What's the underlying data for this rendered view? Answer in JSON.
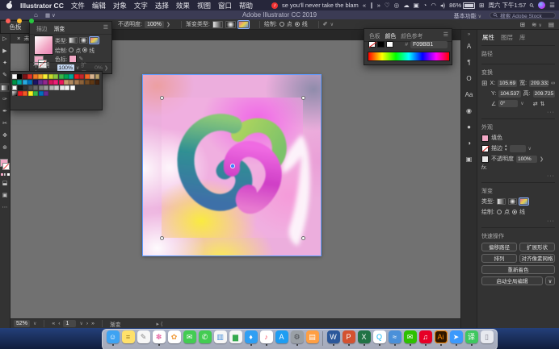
{
  "menu_bar": {
    "app_menu": "Illustrator CC",
    "menus": [
      "文件",
      "编辑",
      "对象",
      "文字",
      "选择",
      "效果",
      "视图",
      "窗口",
      "帮助"
    ],
    "now_playing": "se you'll never take the blam",
    "battery": "86%",
    "clock": "周六 下午1:57"
  },
  "title_bar": {
    "title": "Adobe Illustrator CC 2019",
    "workspace": "基本功能",
    "stock_search_placeholder": "搜索 Adobe Stock"
  },
  "options_bar": {
    "opacity_label": "不透明度:",
    "opacity_value": "100%",
    "gradient_type_label": "渐变类型:",
    "draw_label": "绘制:",
    "draw_point": "点",
    "draw_line": "线"
  },
  "document_tab": {
    "close": "×",
    "title": "未标题"
  },
  "swatches_panel_tab": "色板",
  "gradient_panel": {
    "tabs": [
      "描边",
      "渐变"
    ],
    "type_label": "类型:",
    "draw_label": "绘制:",
    "draw_point": "点",
    "draw_line": "线",
    "stops_label": "色标:",
    "opacity_label": "不透明度:",
    "opacity_value": "100%",
    "spread_label": "扩展:",
    "spread_value": "0%"
  },
  "swatches": {
    "rows": [
      [
        "#ffffff",
        "#000000",
        "#7c1316",
        "#e2322a",
        "#ef7923",
        "#f3a72e",
        "#f8ef34",
        "#c5d92d",
        "#8cc63f",
        "#39b54a",
        "#00a651",
        "#00a99d",
        "#ed1c24",
        "#c1272d",
        "#f26522",
        "#d9b48f",
        "#b8a06a"
      ],
      [
        "#009245",
        "#00a99d",
        "#29abe2",
        "#0071bc",
        "#1b1464",
        "#662d91",
        "#93278f",
        "#d4145a",
        "#ed1e79",
        "#ed145b",
        "#c69c6e",
        "#b0895f",
        "#a67c52",
        "#8c6239",
        "#754c24",
        "#603813",
        "#42210b"
      ],
      [
        "reg",
        "#1a1a1a",
        "#333333",
        "#4d4d4d",
        "#666666",
        "#808080",
        "#999999",
        "#b3b3b3",
        "#cccccc",
        "#e6e6e6",
        "#f2f2f2",
        "#ffffff"
      ],
      [
        "grad",
        "#ed1c24",
        "#f15a24",
        "#fcee21",
        "#39b54a",
        "#0071bc",
        "#662d91"
      ]
    ]
  },
  "color_panel": {
    "tabs": [
      "色板",
      "颜色",
      "颜色参考"
    ],
    "hex_label": "#",
    "hex_value": "F09BB1"
  },
  "properties_panel": {
    "tabs": [
      "属性",
      "图层",
      "库"
    ],
    "selection_type": "路径",
    "transform": {
      "title": "变换",
      "x_label": "X:",
      "x": "105.69 p",
      "w_label": "宽:",
      "w": "209.333",
      "y_label": "Y:",
      "y": "104.537",
      "h_label": "高:",
      "h": "209.725",
      "angle": "0°",
      "more": "···"
    },
    "appearance": {
      "title": "外观",
      "fill_label": "填色",
      "stroke_label": "描边",
      "opacity_label": "不透明度",
      "opacity_value": "100%",
      "fx": "fx.",
      "more": "···"
    },
    "gradient_section": {
      "title": "渐变",
      "type_label": "类型:",
      "draw_label": "绘制:",
      "draw_point": "点",
      "draw_line": "线",
      "more": "···"
    },
    "quick_actions": {
      "title": "快速操作",
      "buttons": [
        "偏移路径",
        "扩展形状",
        "排列",
        "对齐像素网格",
        "重新着色",
        "启动全局编辑"
      ]
    }
  },
  "status_bar": {
    "zoom": "52%",
    "artboard": "1",
    "tool": "渐变"
  },
  "canvas": {
    "selection_color": "#5f9bff",
    "stop_color": "#F09BB1",
    "artwork_colors": [
      "#ecaedd",
      "#f8ef34",
      "#e85fe0",
      "#2f8f93",
      "#8bc878",
      "#cf3ec6",
      "#ffffff"
    ]
  },
  "tools": [
    {
      "name": "selection-tool",
      "glyph": "▷"
    },
    {
      "name": "direct-selection-tool",
      "glyph": "▶"
    },
    {
      "name": "magic-wand-tool",
      "glyph": "✦"
    },
    {
      "name": "shaper-tool",
      "glyph": "✎"
    },
    {
      "name": "gradient-tool",
      "glyph": "",
      "selected": true
    },
    {
      "name": "eyedropper-tool",
      "glyph": "✑"
    },
    {
      "name": "pen-tool",
      "glyph": "✒"
    },
    {
      "name": "scissors-tool",
      "glyph": "✂"
    },
    {
      "name": "hand-tool",
      "glyph": "✥"
    },
    {
      "name": "zoom-tool",
      "glyph": "⊕"
    }
  ],
  "right_strip_icons": [
    {
      "name": "character-panel",
      "glyph": "A"
    },
    {
      "name": "paragraph-panel",
      "glyph": "¶"
    },
    {
      "name": "opentype-panel",
      "glyph": "O"
    },
    {
      "name": "glyphs-panel",
      "glyph": "Aa"
    },
    {
      "name": "appearance-panel",
      "glyph": "◉"
    },
    {
      "name": "color-panel",
      "glyph": "●"
    },
    {
      "name": "transparency-panel",
      "glyph": "◑"
    },
    {
      "name": "artboards-panel",
      "glyph": "▣"
    }
  ],
  "dock": {
    "apps": [
      {
        "name": "finder",
        "glyph": "☺",
        "bg": "#3ea3f2",
        "fg": "#ffffff",
        "running": true
      },
      {
        "name": "notes",
        "glyph": "≡",
        "bg": "#ffe16b",
        "fg": "#a07d1e",
        "running": false
      },
      {
        "name": "textedit",
        "glyph": "✎",
        "bg": "#f6f6f6",
        "fg": "#888888",
        "running": false
      },
      {
        "name": "photos",
        "glyph": "✽",
        "bg": "#ffffff",
        "fg": "#e86aa6",
        "running": true
      },
      {
        "name": "gallery",
        "glyph": "✿",
        "bg": "#ffffff",
        "fg": "#f09c3c",
        "running": false
      },
      {
        "name": "messages",
        "glyph": "✉",
        "bg": "#43cc52",
        "fg": "#ffffff",
        "running": false
      },
      {
        "name": "facetime",
        "glyph": "✆",
        "bg": "#43cc52",
        "fg": "#ffffff",
        "running": false
      },
      {
        "name": "grab",
        "glyph": "▥",
        "bg": "#f6f6f6",
        "fg": "#4a90d9",
        "running": false
      },
      {
        "name": "numbers",
        "glyph": "▆",
        "bg": "#f6f6f6",
        "fg": "#35a94e",
        "running": false
      },
      {
        "name": "keynote",
        "glyph": "♦",
        "bg": "#2f9ff3",
        "fg": "#ffffff",
        "running": true
      },
      {
        "name": "music",
        "glyph": "♪",
        "bg": "#ffffff",
        "fg": "#fa4b60",
        "running": true
      },
      {
        "name": "appstore",
        "glyph": "A",
        "bg": "#1e9df2",
        "fg": "#ffffff",
        "running": false
      },
      {
        "name": "system-preferences",
        "glyph": "⚙",
        "bg": "#9aa0a6",
        "fg": "#4a4d52",
        "running": true
      },
      {
        "name": "books",
        "glyph": "▤",
        "bg": "#ff9f43",
        "fg": "#ffffff",
        "running": false
      },
      {
        "separator": true
      },
      {
        "name": "word",
        "glyph": "W",
        "bg": "#2b579a",
        "fg": "#ffffff",
        "running": true
      },
      {
        "name": "powerpoint",
        "glyph": "P",
        "bg": "#d35230",
        "fg": "#ffffff",
        "running": true
      },
      {
        "name": "excel",
        "glyph": "X",
        "bg": "#217346",
        "fg": "#ffffff",
        "running": true
      },
      {
        "name": "qq",
        "glyph": "Q",
        "bg": "#ffffff",
        "fg": "#12b7f5",
        "running": true
      },
      {
        "name": "proxy-app",
        "glyph": "≈",
        "bg": "#4a90d9",
        "fg": "#ffffff",
        "running": true
      },
      {
        "name": "wechat",
        "glyph": "✉",
        "bg": "#2dc100",
        "fg": "#ffffff",
        "running": true
      },
      {
        "name": "netease-music",
        "glyph": "♫",
        "bg": "#e60026",
        "fg": "#ffffff",
        "running": true
      },
      {
        "name": "illustrator",
        "glyph": "Ai",
        "bg": "#2d1600",
        "fg": "#ff8a00",
        "border": "#ff8a00",
        "running": true
      },
      {
        "name": "screen-share",
        "glyph": "➤",
        "bg": "#3b99fc",
        "fg": "#ffffff",
        "running": true
      },
      {
        "name": "youdao-dict",
        "glyph": "译",
        "bg": "#3fc75f",
        "fg": "#ffffff",
        "running": true
      },
      {
        "name": "trash",
        "glyph": "▯",
        "bg": "#e7e9ef",
        "fg": "#8a8a96",
        "running": false
      }
    ]
  }
}
